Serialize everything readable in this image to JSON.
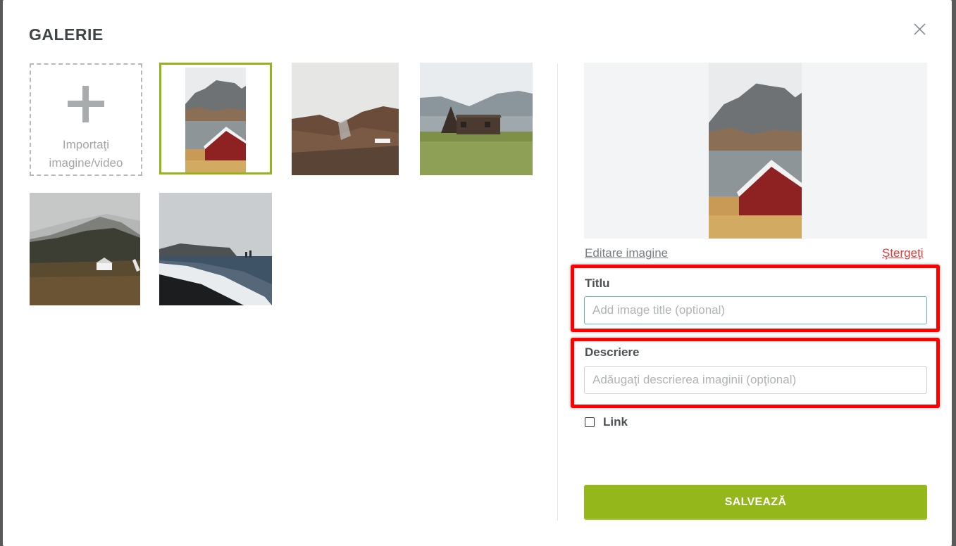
{
  "modal": {
    "title": "GALERIE",
    "close_icon": "close-icon"
  },
  "gallery": {
    "upload_label": "Importaţi imagine/video",
    "upload_icon": "plus-icon",
    "items": [
      {
        "name": "red-cabin-mountain",
        "selected": true
      },
      {
        "name": "foggy-hills"
      },
      {
        "name": "a-frame-cabin"
      },
      {
        "name": "faroe-coast"
      },
      {
        "name": "black-sand-beach"
      }
    ]
  },
  "detail": {
    "edit_link": "Editare imagine",
    "delete_link": "Ştergeţi",
    "title_label": "Titlu",
    "title_placeholder": "Add image title (optional)",
    "title_value": "",
    "description_label": "Descriere",
    "description_placeholder": "Adăugaţi descrierea imaginii (opţional)",
    "description_value": "",
    "link_label": "Link",
    "link_checked": false,
    "save_label": "SALVEAZĂ"
  },
  "colors": {
    "accent": "#94b71c",
    "delete": "#e03a3a",
    "highlight": "#ff0000",
    "selected_border": "#93b51b"
  }
}
